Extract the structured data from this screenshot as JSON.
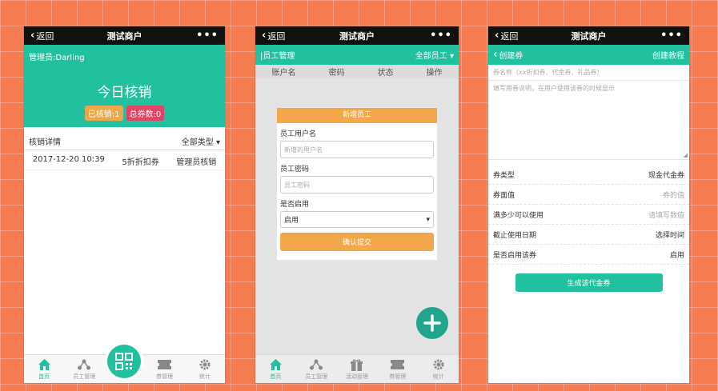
{
  "colors": {
    "brand": "#21c1a0",
    "orange": "#f2a84a",
    "red": "#e04462",
    "topbar": "#111111"
  },
  "topbar": {
    "back_label": "返回",
    "title": "测试商户",
    "more": "•••"
  },
  "phone1": {
    "admin_label": "管理员:Darling",
    "headline": "今日核销",
    "badge_done": "已核销:1",
    "badge_total": "总券数:0",
    "section_title": "核销详情",
    "filter_label": "全部类型",
    "rows": [
      {
        "time": "2017-12-20 10:39",
        "coupon": "5折折扣券",
        "by": "管理员核销"
      }
    ],
    "tabs": [
      {
        "label": "首页",
        "icon": "home-icon"
      },
      {
        "label": "员工管理",
        "icon": "staff-icon"
      },
      {
        "label": "",
        "icon": "qr-scan-icon"
      },
      {
        "label": "券管理",
        "icon": "coupon-icon"
      },
      {
        "label": "统计",
        "icon": "gear-icon"
      }
    ]
  },
  "phone2": {
    "header_title": "|员工管理",
    "header_filter": "全部员工",
    "columns": [
      "账户名",
      "密码",
      "状态",
      "操作"
    ],
    "modal": {
      "title": "新增员工",
      "username_label": "员工用户名",
      "username_placeholder": "新增的用户名",
      "password_label": "员工密码",
      "password_placeholder": "员工密码",
      "enabled_label": "是否启用",
      "enabled_value": "启用",
      "submit_label": "确认提交"
    },
    "tabs": [
      {
        "label": "首页",
        "icon": "home-icon"
      },
      {
        "label": "员工管理",
        "icon": "staff-icon"
      },
      {
        "label": "活动管理",
        "icon": "gift-icon"
      },
      {
        "label": "券管理",
        "icon": "coupon-icon"
      },
      {
        "label": "统计",
        "icon": "gear-icon"
      }
    ]
  },
  "phone3": {
    "header_back": "创建券",
    "header_link": "创建教程",
    "name_placeholder": "券名称（xx折扣券、代金券、礼品券）",
    "desc_placeholder": "填写用券说明，在用户使用该券的时候显示",
    "fields": [
      {
        "label": "券类型",
        "value": "现金代金券",
        "placeholder": false
      },
      {
        "label": "券面值",
        "value": "券的值",
        "placeholder": true
      },
      {
        "label": "满多少可以使用",
        "value": "请填写数值",
        "placeholder": true
      },
      {
        "label": "截止使用日期",
        "value": "选择时间",
        "placeholder": false
      },
      {
        "label": "是否启用该券",
        "value": "启用",
        "placeholder": false
      }
    ],
    "submit_label": "生成该代金券"
  }
}
